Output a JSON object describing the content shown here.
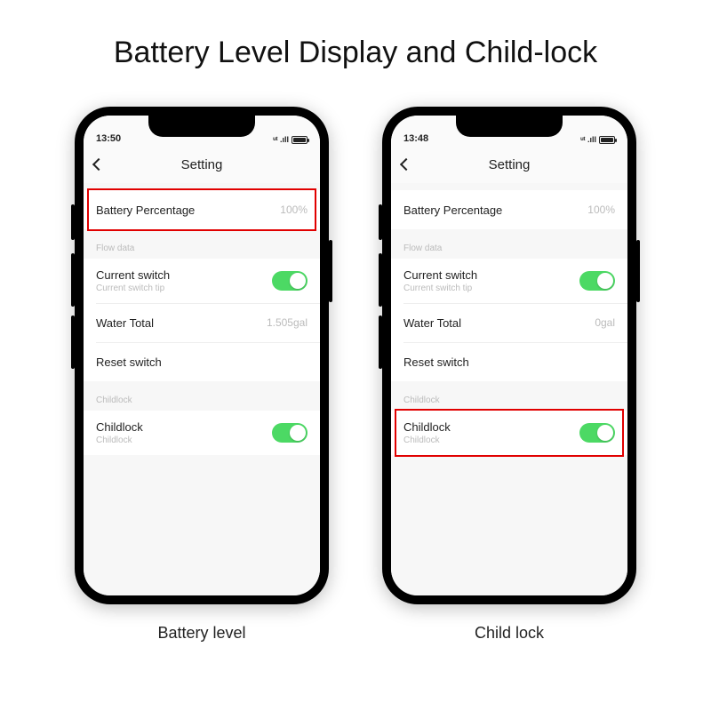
{
  "title": "Battery Level Display and Child-lock",
  "phones": [
    {
      "status": {
        "time": "13:50",
        "signal": "ᵘᵗ .ıll",
        "battery": "36"
      },
      "nav": {
        "title": "Setting"
      },
      "rows": {
        "battery": {
          "label": "Battery Percentage",
          "value": "100%"
        },
        "section_flow": "Flow data",
        "current": {
          "label": "Current switch",
          "sub": "Current switch tip"
        },
        "water": {
          "label": "Water Total",
          "value": "1.505gal"
        },
        "reset": {
          "label": "Reset switch"
        },
        "section_lock": "Childlock",
        "childlock": {
          "label": "Childlock",
          "sub": "Childlock"
        }
      },
      "caption": "Battery level",
      "highlight": "battery"
    },
    {
      "status": {
        "time": "13:48",
        "signal": "ᵘᵗ .ıll",
        "battery": "36"
      },
      "nav": {
        "title": "Setting"
      },
      "rows": {
        "battery": {
          "label": "Battery Percentage",
          "value": "100%"
        },
        "section_flow": "Flow data",
        "current": {
          "label": "Current switch",
          "sub": "Current switch tip"
        },
        "water": {
          "label": "Water Total",
          "value": "0gal"
        },
        "reset": {
          "label": "Reset switch"
        },
        "section_lock": "Childlock",
        "childlock": {
          "label": "Childlock",
          "sub": "Childlock"
        }
      },
      "caption": "Child lock",
      "highlight": "childlock"
    }
  ]
}
